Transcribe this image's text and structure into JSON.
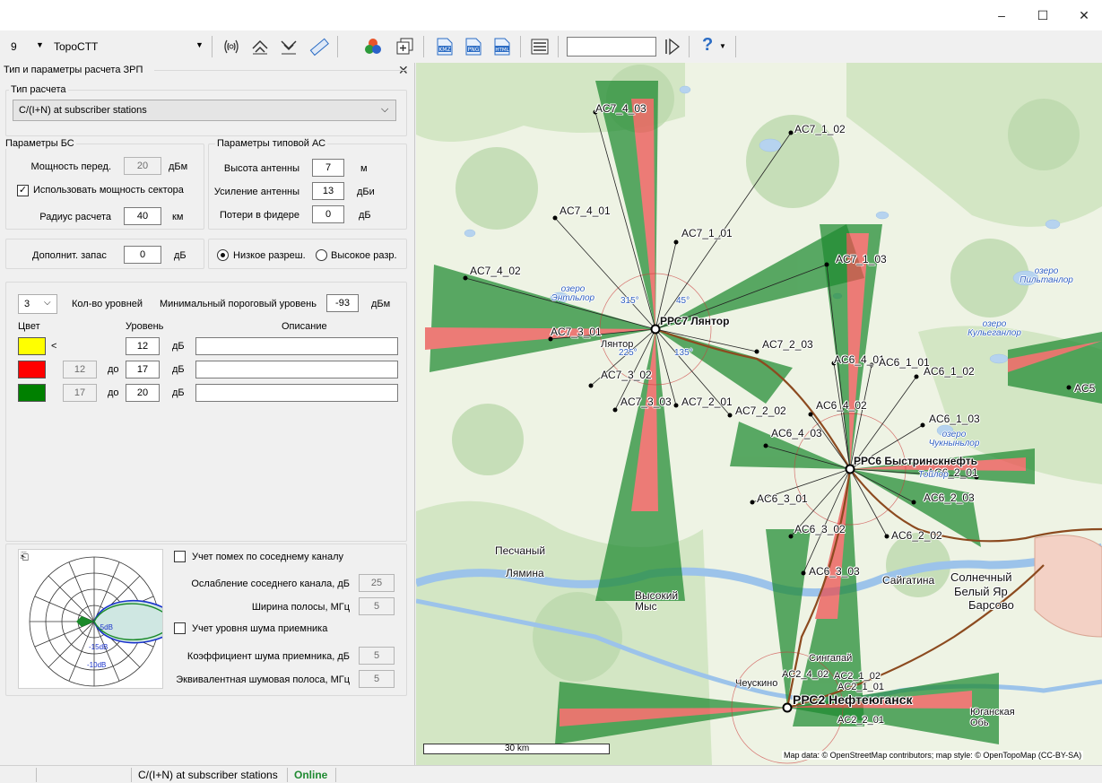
{
  "window": {
    "min": "–",
    "max": "☐",
    "close": "✕"
  },
  "toolbar": {
    "zoom_level": "9",
    "map_source": "TopoCTT",
    "search_value": "",
    "help_label": "?"
  },
  "panel": {
    "title": "Тип и параметры расчета ЗРП",
    "close": "✕",
    "calc_type_group": "Тип расчета",
    "calc_type_value": "C/(I+N) at subscriber stations",
    "bs_group": "Параметры БС",
    "bs_power_label": "Мощность перед.",
    "bs_power_value": "20",
    "bs_power_unit": "дБм",
    "use_sector_power_label": "Использовать мощность сектора",
    "use_sector_power_checked": true,
    "radius_label": "Радиус расчета",
    "radius_value": "40",
    "radius_unit": "км",
    "as_group": "Параметры типовой АС",
    "ant_height_label": "Высота антенны",
    "ant_height_value": "7",
    "ant_height_unit": "м",
    "ant_gain_label": "Усиление антенны",
    "ant_gain_value": "13",
    "ant_gain_unit": "дБи",
    "feeder_loss_label": "Потери в фидере",
    "feeder_loss_value": "0",
    "feeder_loss_unit": "дБ",
    "margin_label": "Дополнит. запас",
    "margin_value": "0",
    "margin_unit": "дБ",
    "res_low_label": "Низкое разреш.",
    "res_high_label": "Высокое разр.",
    "res_selected": "low",
    "levels_count": "3",
    "levels_count_label": "Кол-во уровней",
    "min_threshold_label": "Минимальный пороговый уровень",
    "min_threshold_value": "-93",
    "min_threshold_unit": "дБм",
    "col_color": "Цвет",
    "col_level": "Уровень",
    "col_desc": "Описание",
    "levels": [
      {
        "color": "#ffff00",
        "from": "",
        "sep": "<",
        "to": "12",
        "unit": "дБ",
        "desc": ""
      },
      {
        "color": "#ff0000",
        "from": "12",
        "sep": "до",
        "to": "17",
        "unit": "дБ",
        "desc": ""
      },
      {
        "color": "#008000",
        "from": "17",
        "sep": "до",
        "to": "20",
        "unit": "дБ",
        "desc": ""
      }
    ],
    "adj_channel_label": "Учет помех по соседнему каналу",
    "adj_atten_label": "Ослабление соседнего канала, дБ",
    "adj_atten_value": "25",
    "bandwidth_label": "Ширина полосы, МГц",
    "bandwidth_value": "5",
    "noise_label": "Учет уровня шума приемника",
    "noise_factor_label": "Коэффициент шума приемника, дБ",
    "noise_factor_value": "5",
    "noise_band_label": "Эквивалентная шумовая полоса, МГц",
    "noise_band_value": "5",
    "pattern_labels": [
      "-5dB",
      "-10dB",
      "-15dB"
    ]
  },
  "map": {
    "stations": [
      {
        "name": "РРС7 Лянтор"
      },
      {
        "name": "РРС6 Быстринскнефть"
      },
      {
        "name": "РРС2 Нефтеюганск"
      }
    ],
    "subscribers": [
      "AC7_4_03",
      "AC7_1_02",
      "AC7_4_01",
      "AC7_1_01",
      "AC7_4_02",
      "AC7_1_03",
      "AC7_3_01",
      "AC7_2_03",
      "AC7_3_02",
      "AC6_4_01",
      "AC6_1_01",
      "AC6_1_02",
      "AC7_3_03",
      "AC7_2_01",
      "AC7_2_02",
      "AC6_4_02",
      "AC6_1_03",
      "AC6_4_03",
      "AC6_2_01",
      "AC6_3_01",
      "AC6_2_03",
      "AC6_3_02",
      "AC6_2_02",
      "AC6_3_03",
      "AC5",
      "AC2_4_02",
      "AC2_1_02",
      "AC2_1_01",
      "AC2_2_01"
    ],
    "places": [
      "Лянтор",
      "Песчаный",
      "Лямина",
      "Высокий Мыс",
      "Сайгатина",
      "Солнечный",
      "Белый Яр",
      "Барсово",
      "Сингапай",
      "Чеускино",
      "Юганская Обь"
    ],
    "lakes": [
      "озеро Энтльлор",
      "озеро Пильтанлор",
      "озеро Кульеганлор",
      "озеро Чукныньлор",
      "Тойлор"
    ],
    "angle_labels": [
      "315°",
      "45°",
      "225°",
      "135°"
    ],
    "scale_label": "30 km",
    "attribution": "Map data: © OpenStreetMap contributors; map style: © OpenTopoMap (CC-BY-SA)"
  },
  "status": {
    "mode": "C/(I+N) at subscriber stations",
    "state": "Online"
  }
}
